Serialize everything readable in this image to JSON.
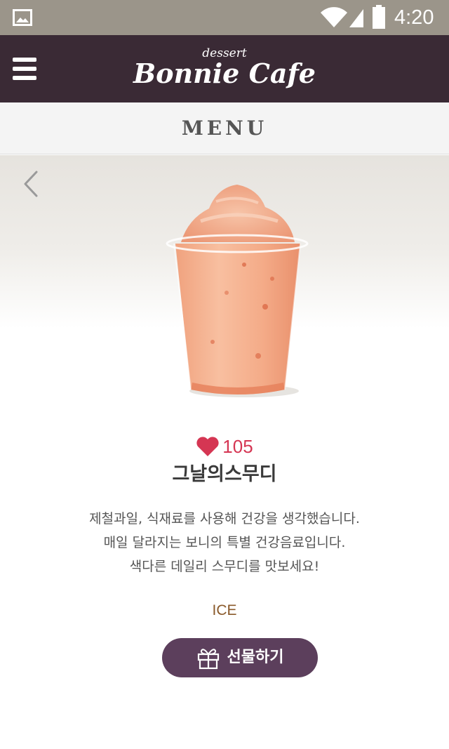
{
  "status_bar": {
    "time": "4:20",
    "icons": [
      "gallery-icon",
      "wifi-icon",
      "signal-icon",
      "battery-icon"
    ]
  },
  "header": {
    "brand_small": "dessert",
    "brand_main": "Bonnie Cafe",
    "menu_icon": "hamburger-menu-icon",
    "colors": {
      "background": "#3a2a35",
      "text": "#ffffff"
    }
  },
  "section": {
    "title": "MENU"
  },
  "product": {
    "image_icon": "smoothie-cup-image",
    "likes": "105",
    "name": "그날의스무디",
    "description_lines": [
      "제철과일, 식재료를 사용해 건강을 생각했습니다.",
      "매일 달라지는 보니의 특별 건강음료입니다.",
      "색다른 데일리 스무디를 맛보세요!"
    ],
    "temperature": "ICE",
    "colors": {
      "likes": "#d53653",
      "temperature": "#8a5a2b"
    }
  },
  "actions": {
    "back_icon": "chevron-left-icon",
    "gift_label": "선물하기",
    "gift_icon": "gift-icon",
    "gift_color": "#5c3f5c"
  }
}
